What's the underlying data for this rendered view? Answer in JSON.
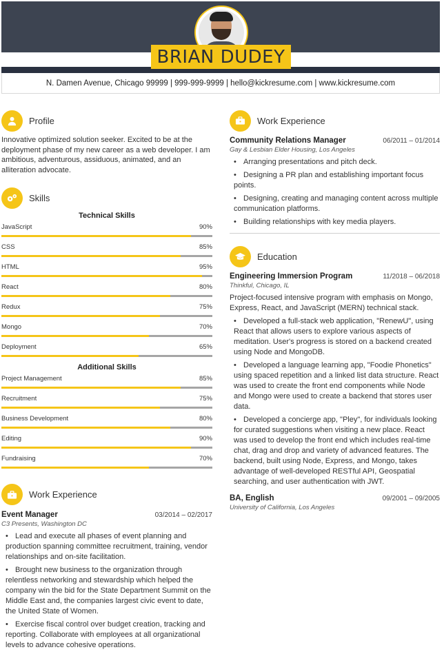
{
  "colors": {
    "accent": "#f5c518",
    "header_bg": "#3d4451",
    "track": "#a5a5a5"
  },
  "header": {
    "name": "BRIAN DUDEY",
    "contact": "N. Damen Avenue, Chicago 99999 | 999-999-9999 | hello@kickresume.com | www.kickresume.com"
  },
  "profile": {
    "title": "Profile",
    "icon": "user-icon",
    "text": "Innovative optimized solution seeker. Excited to be at the deployment phase of my new career as a web developer. I am ambitious, adventurous, assiduous, animated, and an alliteration advocate."
  },
  "skills": {
    "title": "Skills",
    "icon": "gears-icon",
    "technical_title": "Technical Skills",
    "technical": [
      {
        "name": "JavaScript",
        "pct": "90%",
        "level": 90
      },
      {
        "name": "CSS",
        "pct": "85%",
        "level": 85
      },
      {
        "name": "HTML",
        "pct": "95%",
        "level": 95
      },
      {
        "name": "React",
        "pct": "80%",
        "level": 80
      },
      {
        "name": "Redux",
        "pct": "75%",
        "level": 75
      },
      {
        "name": "Mongo",
        "pct": "70%",
        "level": 70
      },
      {
        "name": "Deployment",
        "pct": "65%",
        "level": 65
      }
    ],
    "additional_title": "Additional Skills",
    "additional": [
      {
        "name": "Project Management",
        "pct": "85%",
        "level": 85
      },
      {
        "name": "Recruitment",
        "pct": "75%",
        "level": 75
      },
      {
        "name": "Business Development",
        "pct": "80%",
        "level": 80
      },
      {
        "name": "Editing",
        "pct": "90%",
        "level": 90
      },
      {
        "name": "Fundraising",
        "pct": "70%",
        "level": 70
      }
    ]
  },
  "work_left": {
    "title": "Work Experience",
    "icon": "briefcase-icon",
    "job": {
      "title": "Event Manager",
      "date": "03/2014 – 02/2017",
      "org": "C3 Presents, Washington DC",
      "bullets": [
        "Lead and execute all phases of event planning and production spanning committee recruitment, training, vendor relationships and on-site facilitation.",
        "Brought new business to the organization through relentless networking and stewardship which helped the company win the bid for the State Department Summit on the Middle East and, the companies largest civic event to date, the United State of Women.",
        "Exercise fiscal control over budget creation, tracking and reporting. Collaborate with employees at all organizational levels to advance cohesive operations."
      ]
    }
  },
  "work_right": {
    "title": "Work Experience",
    "icon": "briefcase-icon",
    "job": {
      "title": "Community Relations Manager",
      "date": "06/2011 – 01/2014",
      "org": "Gay & Lesbian Elder Housing, Los Angeles",
      "bullets": [
        "Arranging presentations and pitch deck.",
        "Designing a PR plan and establishing important focus points.",
        "Designing, creating and managing content across multiple communication platforms.",
        "Building relationships with key media players."
      ]
    }
  },
  "education": {
    "title": "Education",
    "icon": "graduation-cap-icon",
    "entries": [
      {
        "title": "Engineering Immersion Program",
        "date": "11/2018 – 06/2018",
        "org": "Thinkful, Chicago, IL",
        "summary": "Project-focused intensive program with emphasis on Mongo, Express, React, and JavaScript (MERN) technical stack.",
        "bullets": [
          "Developed a full-stack web application, \"RenewU\", using React that allows users to explore various aspects of meditation. User's progress is stored on a backend created using Node and MongoDB.",
          "Developed a language learning app, \"Foodie Phonetics\" using spaced repetition and a linked list data structure. React was used to create the front end components while Node and Mongo were used to create a backend that stores user data.",
          "Developed a concierge app, \"Pley\", for individuals looking for curated suggestions when visiting a new place. React was used to develop the front end which includes real-time chat, drag and drop and variety of advanced features. The backend, built using Node, Express, and Mongo, takes advantage of well-developed RESTful API, Geospatial searching, and user authentication with JWT."
        ]
      },
      {
        "title": "BA, English",
        "date": "09/2001 – 09/2005",
        "org": "University of California, Los Angeles"
      }
    ]
  }
}
